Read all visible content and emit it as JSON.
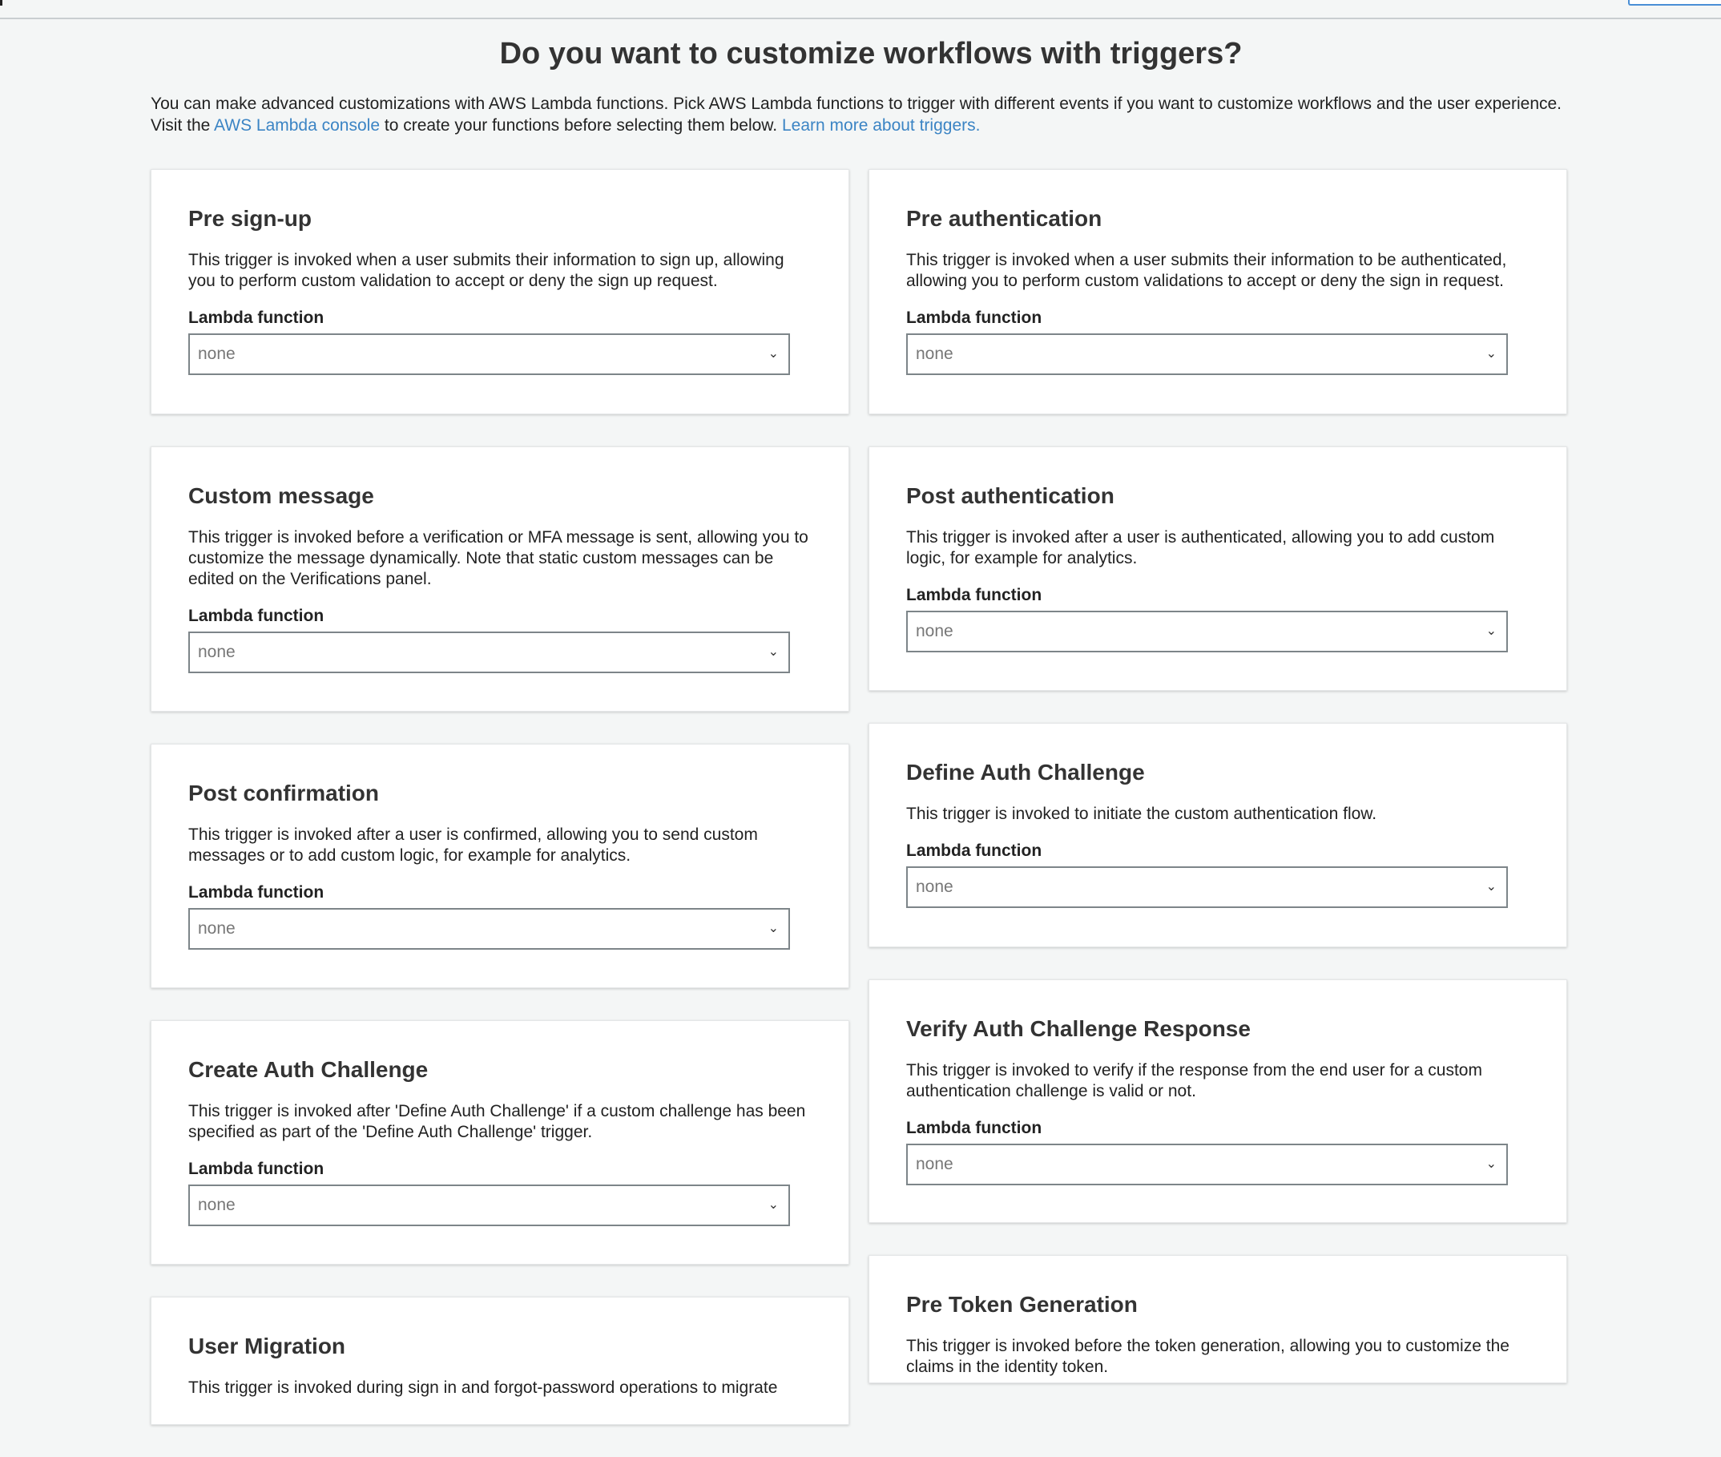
{
  "page": {
    "title": "Do you want to customize workflows with triggers?",
    "intro_line1": "You can make advanced customizations with AWS Lambda functions. Pick AWS Lambda functions to trigger with different events if you want to customize workflows and the user experience.",
    "intro_visit": "Visit the",
    "lambda_console_link": "AWS Lambda console",
    "intro_after_link": "to create your functions before selecting them below.",
    "learn_more_link": "Learn more about triggers."
  },
  "common": {
    "lambda_label": "Lambda function",
    "select_value": "none"
  },
  "cards": {
    "pre_signup": {
      "title": "Pre sign-up",
      "desc": "This trigger is invoked when a user submits their information to sign up, allowing you to perform custom validation to accept or deny the sign up request."
    },
    "pre_auth": {
      "title": "Pre authentication",
      "desc": "This trigger is invoked when a user submits their information to be authenticated, allowing you to perform custom validations to accept or deny the sign in request."
    },
    "custom_message": {
      "title": "Custom message",
      "desc": "This trigger is invoked before a verification or MFA message is sent, allowing you to customize the message dynamically. Note that static custom messages can be edited on the Verifications panel."
    },
    "post_auth": {
      "title": "Post authentication",
      "desc": "This trigger is invoked after a user is authenticated, allowing you to add custom logic, for example for analytics."
    },
    "post_confirmation": {
      "title": "Post confirmation",
      "desc": "This trigger is invoked after a user is confirmed, allowing you to send custom messages or to add custom logic, for example for analytics."
    },
    "define_auth": {
      "title": "Define Auth Challenge",
      "desc": "This trigger is invoked to initiate the custom authentication flow."
    },
    "create_auth": {
      "title": "Create Auth Challenge",
      "desc": "This trigger is invoked after 'Define Auth Challenge' if a custom challenge has been specified as part of the 'Define Auth Challenge' trigger."
    },
    "verify_auth": {
      "title": "Verify Auth Challenge Response",
      "desc": "This trigger is invoked to verify if the response from the end user for a custom authentication challenge is valid or not."
    },
    "user_migration": {
      "title": "User Migration",
      "desc": "This trigger is invoked during sign in and forgot-password operations to migrate"
    },
    "pre_token": {
      "title": "Pre Token Generation",
      "desc": "This trigger is invoked before the token generation, allowing you to customize the claims in the identity token."
    }
  },
  "icons": {
    "dropdown": "chevron-down-icon"
  }
}
